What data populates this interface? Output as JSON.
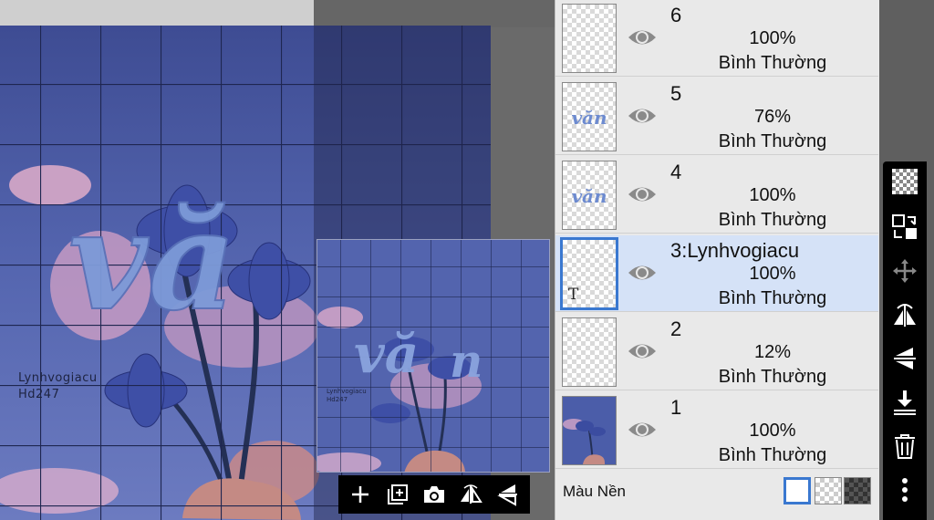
{
  "artwork": {
    "title_text": "văn",
    "credit_line1": "Lynhvogiacu",
    "credit_line2": "Hd247"
  },
  "preview": {
    "title_text": "văn",
    "credit_line1": "Lynhvogiacu",
    "credit_line2": "Hd247"
  },
  "bottom_bar": {
    "add_icon": "plus-icon",
    "add_layer_icon": "add-layer-icon",
    "camera_icon": "camera-icon",
    "flip_h_icon": "flip-horizontal-icon",
    "flip_v_icon": "flip-vertical-icon"
  },
  "layers": [
    {
      "name": "6",
      "opacity": "100%",
      "mode": "Bình Thường",
      "thumb": "",
      "selected": false
    },
    {
      "name": "5",
      "opacity": "76%",
      "mode": "Bình Thường",
      "thumb": "văn",
      "selected": false
    },
    {
      "name": "4",
      "opacity": "100%",
      "mode": "Bình Thường",
      "thumb": "văn",
      "selected": false
    },
    {
      "name": "3:Lynhvogiacu",
      "opacity": "100%",
      "mode": "Bình Thường",
      "thumb": "T",
      "selected": true
    },
    {
      "name": "2",
      "opacity": "12%",
      "mode": "Bình Thường",
      "thumb": "",
      "selected": false
    },
    {
      "name": "1",
      "opacity": "100%",
      "mode": "Bình Thường",
      "thumb": "image",
      "selected": false
    }
  ],
  "background": {
    "label": "Màu Nền",
    "options": [
      "white",
      "transparent",
      "dark"
    ]
  },
  "toolbar": {
    "icons": [
      "checkerboard-icon",
      "swap-layers-icon",
      "move-icon",
      "flip-horizontal-icon",
      "flip-vertical-icon",
      "merge-down-icon",
      "trash-icon",
      "more-icon"
    ]
  },
  "colors": {
    "accent": "#3a78d0",
    "selected_row": "#d5e2f7",
    "artwork_blue": "#4a5fa8",
    "lettering": "#7d9ad8"
  }
}
